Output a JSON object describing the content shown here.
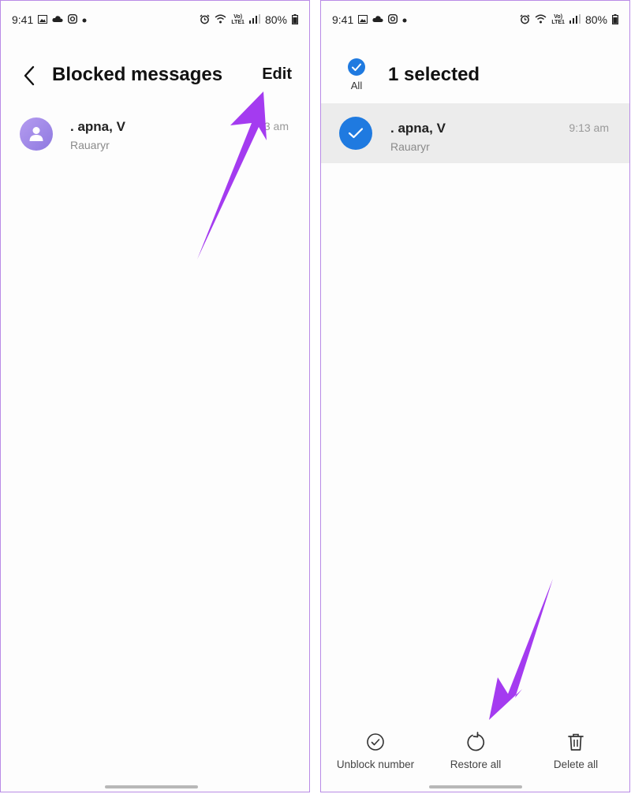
{
  "status_bar": {
    "time": "9:41",
    "volte_top": "Vo)",
    "volte_bottom": "LTE1",
    "battery": "80%"
  },
  "left_screen": {
    "title": "Blocked messages",
    "edit_label": "Edit",
    "message": {
      "sender": ". apna, V",
      "preview": "Rauaryr",
      "time": "3 am"
    }
  },
  "right_screen": {
    "select_all_label": "All",
    "selected_count": "1 selected",
    "message": {
      "sender": ". apna, V",
      "preview": "Rauaryr",
      "time": "9:13 am"
    },
    "actions": {
      "unblock": "Unblock number",
      "restore": "Restore all",
      "delete": "Delete all"
    }
  },
  "colors": {
    "accent": "#1f7ae0",
    "arrow": "#a43bf0",
    "panel_border": "#b98be6"
  }
}
